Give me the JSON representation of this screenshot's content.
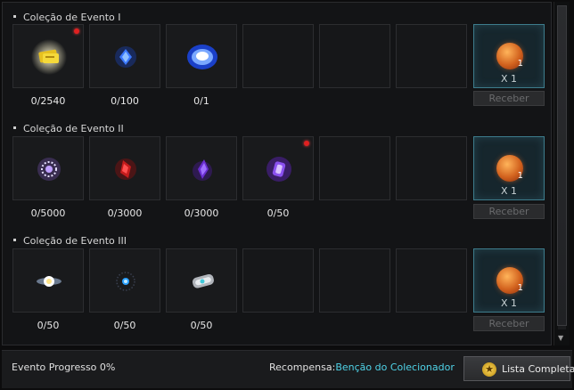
{
  "sections": [
    {
      "title": "Coleção de Evento I",
      "slots": [
        {
          "icon": "gold-ticket-icon",
          "count": "0/2540",
          "badge": true
        },
        {
          "icon": "blue-crystal-icon",
          "count": "0/100",
          "badge": false
        },
        {
          "icon": "blue-orb-icon",
          "count": "0/1",
          "badge": false
        }
      ],
      "reward": {
        "icon": "orange-sphere-icon",
        "quantity": "1",
        "multiplier": "X 1",
        "button": "Receber"
      }
    },
    {
      "title": "Coleção de Evento II",
      "slots": [
        {
          "icon": "silver-emblem-icon",
          "count": "0/5000",
          "badge": false
        },
        {
          "icon": "red-shard-icon",
          "count": "0/3000",
          "badge": false
        },
        {
          "icon": "purple-shard-icon",
          "count": "0/3000",
          "badge": false
        },
        {
          "icon": "purple-gem-icon",
          "count": "0/50",
          "badge": true
        }
      ],
      "reward": {
        "icon": "orange-sphere-icon",
        "quantity": "1",
        "multiplier": "X 1",
        "button": "Receber"
      }
    },
    {
      "title": "Coleção de Evento III",
      "slots": [
        {
          "icon": "light-orb-icon",
          "count": "0/50",
          "badge": false
        },
        {
          "icon": "blue-amulet-icon",
          "count": "0/50",
          "badge": false
        },
        {
          "icon": "silver-bracelet-icon",
          "count": "0/50",
          "badge": false
        }
      ],
      "reward": {
        "icon": "orange-sphere-icon",
        "quantity": "1",
        "multiplier": "X 1",
        "button": "Receber"
      }
    }
  ],
  "footer": {
    "progress": "Evento Progresso 0%",
    "reward_prefix": "Recompensa:",
    "reward_name": "Benção do Colecionador",
    "list_button": "Lista Completa"
  }
}
